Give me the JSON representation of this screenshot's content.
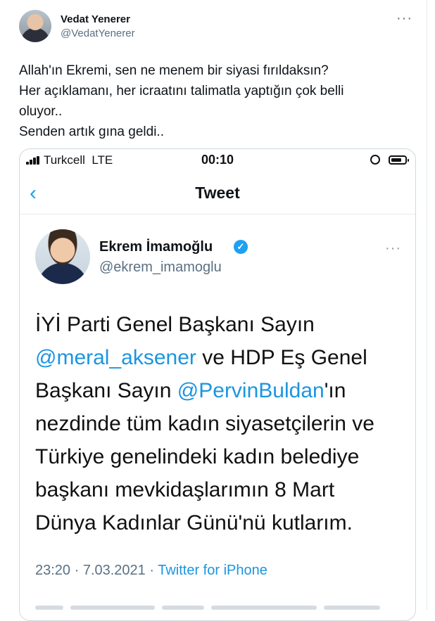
{
  "tweet": {
    "author_name": "Vedat Yenerer",
    "author_handle": "@VedatYenerer",
    "more_label": "···",
    "text_lines": [
      "Allah'ın Ekremi, sen ne menem bir siyasi fırıldaksın?",
      "Her açıklamanı, her icraatını talimatla yaptığın çok belli",
      "oluyor..",
      "Senden artık gına geldi.."
    ]
  },
  "screenshot": {
    "status_bar": {
      "carrier": "Turkcell",
      "network": "LTE",
      "time": "00:10"
    },
    "nav": {
      "back_glyph": "‹",
      "title": "Tweet"
    },
    "embedded_tweet": {
      "author_name": "Ekrem İmamoğlu",
      "verified_glyph": "✓",
      "author_handle": "@ekrem_imamoglu",
      "more_label": "···",
      "lines": [
        {
          "before": "İYİ Parti Genel Başkanı Sayın",
          "mention": "",
          "after": ""
        },
        {
          "before": "",
          "mention": "@meral_aksener",
          "after": " ve HDP Eş Genel"
        },
        {
          "before": "Başkanı Sayın ",
          "mention": "@PervinBuldan",
          "after": "'ın"
        },
        {
          "before": "nezdinde tüm kadın siyasetçilerin ve",
          "mention": "",
          "after": ""
        },
        {
          "before": "Türkiye genelindeki kadın belediye",
          "mention": "",
          "after": ""
        },
        {
          "before": "başkanı mevkidaşlarımın 8 Mart",
          "mention": "",
          "after": ""
        },
        {
          "before": "Dünya Kadınlar Günü'nü kutlarım.",
          "mention": "",
          "after": ""
        }
      ],
      "timestamp": "23:20 · 7.03.2021 · ",
      "source": "Twitter for iPhone"
    }
  },
  "colors": {
    "accent": "#1da1f2",
    "mention": "#1b95e0",
    "secondary_text": "#5b7083",
    "border": "#cfd9de"
  },
  "icons": [
    "more-horizontal-icon",
    "signal-icon",
    "rotation-lock-icon",
    "battery-icon",
    "back-chevron-icon",
    "verified-badge-icon"
  ]
}
